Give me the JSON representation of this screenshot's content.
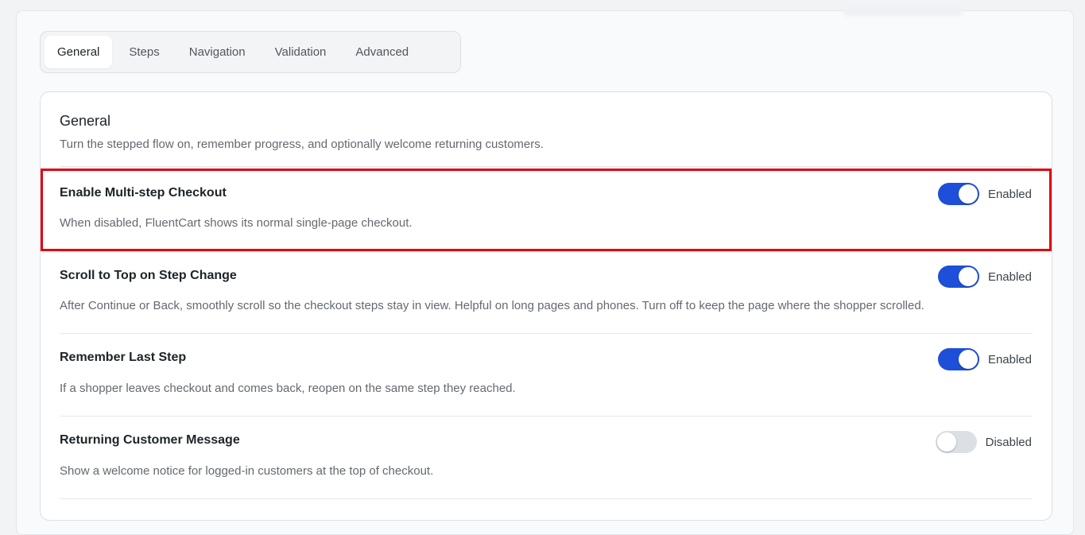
{
  "tabs": [
    {
      "label": "General",
      "active": true
    },
    {
      "label": "Steps",
      "active": false
    },
    {
      "label": "Navigation",
      "active": false
    },
    {
      "label": "Validation",
      "active": false
    },
    {
      "label": "Advanced",
      "active": false
    }
  ],
  "section": {
    "title": "General",
    "description": "Turn the stepped flow on, remember progress, and optionally welcome returning customers."
  },
  "settings": [
    {
      "title": "Enable Multi-step Checkout",
      "description": "When disabled, FluentCart shows its normal single-page checkout.",
      "state": "on",
      "state_label": "Enabled"
    },
    {
      "title": "Scroll to Top on Step Change",
      "description": "After Continue or Back, smoothly scroll so the checkout steps stay in view. Helpful on long pages and phones. Turn off to keep the page where the shopper scrolled.",
      "state": "on",
      "state_label": "Enabled"
    },
    {
      "title": "Remember Last Step",
      "description": "If a shopper leaves checkout and comes back, reopen on the same step they reached.",
      "state": "on",
      "state_label": "Enabled"
    },
    {
      "title": "Returning Customer Message",
      "description": "Show a welcome notice for logged-in customers at the top of checkout.",
      "state": "off",
      "state_label": "Disabled"
    }
  ],
  "colors": {
    "toggle_on": "#1e4fd8",
    "toggle_off": "#dcdfe3",
    "highlight": "#e3000f"
  }
}
